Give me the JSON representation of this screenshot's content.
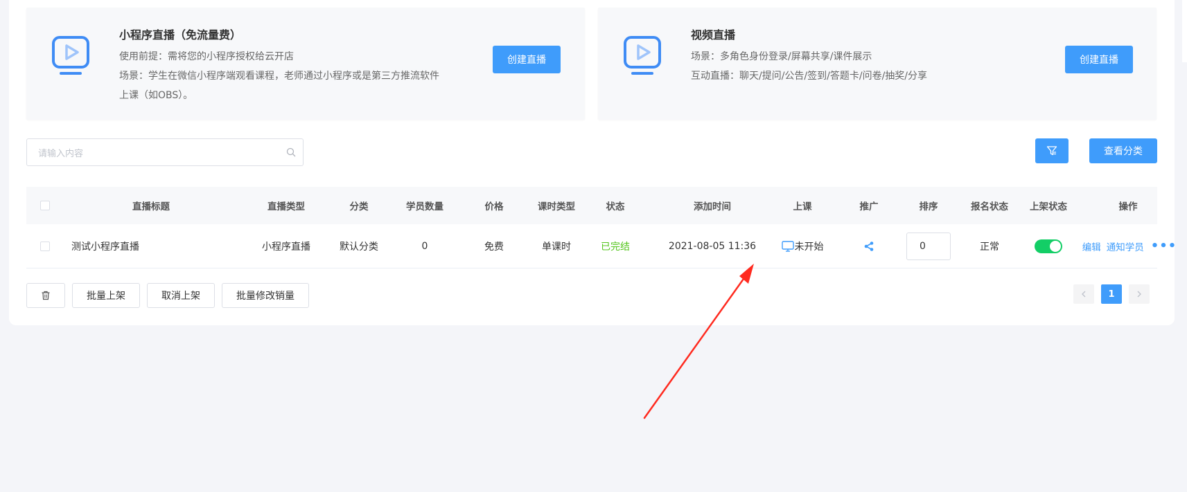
{
  "cards": [
    {
      "title": "小程序直播（免流量费）",
      "line1": "使用前提：需将您的小程序授权给云开店",
      "line2": "场景：学生在微信小程序端观看课程，老师通过小程序或是第三方推流软件",
      "line3": "上课（如OBS）。",
      "button": "创建直播",
      "icon": "live-video-icon"
    },
    {
      "title": "视频直播",
      "line1": "场景：多角色身份登录/屏幕共享/课件展示",
      "line2": "互动直播：聊天/提问/公告/签到/答题卡/问卷/抽奖/分享",
      "button": "创建直播",
      "icon": "live-video-icon"
    }
  ],
  "search": {
    "placeholder": "请输入内容"
  },
  "toolbar": {
    "filter_icon": "filter-icon",
    "category_button": "查看分类"
  },
  "table": {
    "headers": {
      "title": "直播标题",
      "type": "直播类型",
      "category": "分类",
      "students": "学员数量",
      "price": "价格",
      "lesson_type": "课时类型",
      "status": "状态",
      "added": "添加时间",
      "class": "上课",
      "promote": "推广",
      "sort": "排序",
      "signup": "报名状态",
      "shelf": "上架状态",
      "actions": "操作"
    },
    "rows": [
      {
        "title": "测试小程序直播",
        "type": "小程序直播",
        "category": "默认分类",
        "students": "0",
        "price": "免费",
        "lesson_type": "单课时",
        "status": "已完结",
        "added": "2021-08-05 11:36",
        "class": "未开始",
        "sort": "0",
        "signup": "正常",
        "shelf_on": true,
        "edit": "编辑",
        "notify": "通知学员",
        "more": "•••"
      }
    ]
  },
  "bulk": {
    "delete_icon": "trash-icon",
    "on_shelf": "批量上架",
    "off_shelf": "取消上架",
    "edit_sales": "批量修改销量"
  },
  "pagination": {
    "current": "1"
  },
  "colors": {
    "primary": "#3f9cfb",
    "success": "#52c41a",
    "switch_on": "#13ce66",
    "annotation": "#ff2a1f"
  }
}
